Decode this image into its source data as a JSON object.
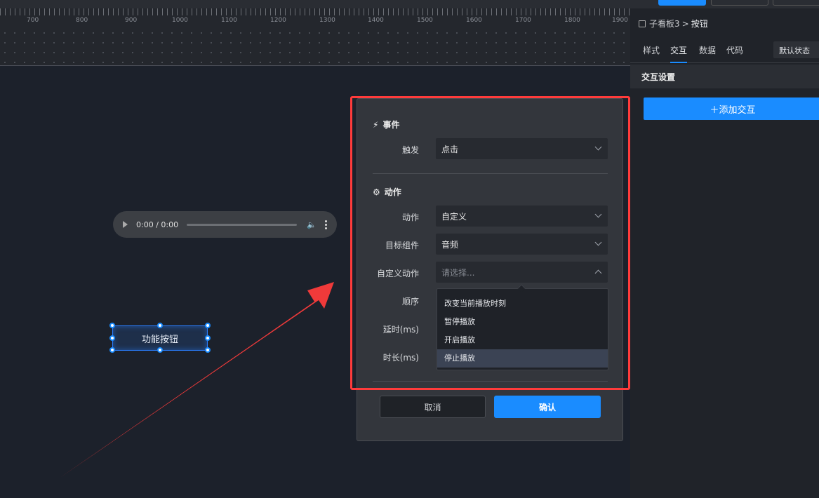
{
  "toolbar": {
    "preview_label": "",
    "save_label": "",
    "more_label": ""
  },
  "ruler": {
    "labels": [
      "700",
      "800",
      "900",
      "1000",
      "1100",
      "1200",
      "1300",
      "1400",
      "1500",
      "1600",
      "1700",
      "1800",
      "1900"
    ]
  },
  "audio": {
    "time": "0:00 / 0:00"
  },
  "canvas": {
    "button_label": "功能按钮"
  },
  "modal": {
    "event_section": "事件",
    "trigger_label": "触发",
    "trigger_value": "点击",
    "action_section": "动作",
    "action_label": "动作",
    "action_value": "自定义",
    "target_label": "目标组件",
    "target_value": "音频",
    "custom_action_label": "自定义动作",
    "custom_action_placeholder": "请选择...",
    "order_label": "顺序",
    "delay_label": "延时(ms)",
    "duration_label": "时长(ms)",
    "dropdown_options": [
      "改变当前播放时刻",
      "暂停播放",
      "开启播放",
      "停止播放"
    ],
    "dropdown_active_index": 3,
    "cancel_label": "取消",
    "confirm_label": "确认"
  },
  "right_panel": {
    "breadcrumb_parent": "子看板3",
    "breadcrumb_sep": ">",
    "breadcrumb_current": "按钮",
    "tabs": [
      "样式",
      "交互",
      "数据",
      "代码"
    ],
    "active_tab": "交互",
    "state_select": "默认状态",
    "section_title": "交互设置",
    "add_button": "＋添加交互"
  },
  "colors": {
    "accent": "#1a8cff",
    "highlight": "#ff3b3b",
    "arrow": "#f03a3a"
  }
}
